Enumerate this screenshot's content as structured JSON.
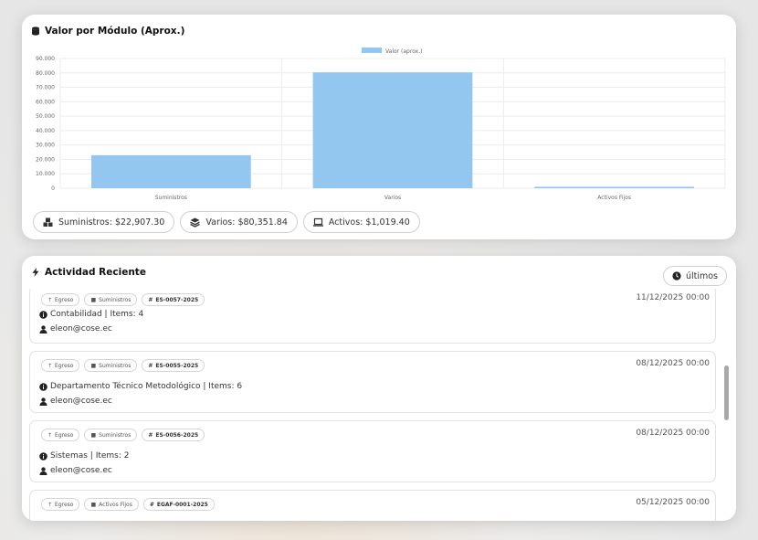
{
  "chart_card": {
    "title": "Valor por Módulo (Aprox.)",
    "icon": "database-icon",
    "pills": [
      {
        "label": "Suministros: $22,907.30",
        "icon": "boxes-icon"
      },
      {
        "label": "Varios: $80,351.84",
        "icon": "layers-icon"
      },
      {
        "label": "Activos: $1,019.40",
        "icon": "laptop-icon"
      }
    ]
  },
  "chart_data": {
    "type": "bar",
    "categories": [
      "Suministros",
      "Varios",
      "Activos Fijos"
    ],
    "series": [
      {
        "name": "Valor (aprox.)",
        "values": [
          22907.3,
          80351.84,
          1019.4
        ],
        "color": "#93c7ef"
      }
    ],
    "yticks": [
      "90.000",
      "80.000",
      "70.000",
      "60.000",
      "50.000",
      "40.000",
      "30.000",
      "20.000",
      "10.000",
      "0"
    ],
    "ylim": [
      0,
      90000
    ],
    "grid": true,
    "legend": "top-center"
  },
  "activity_card": {
    "title": "Actividad Reciente",
    "icon": "bolt-icon",
    "recent_button": {
      "label": "últimos",
      "icon": "clock-icon"
    },
    "entries": [
      {
        "tags": [
          "Egreso",
          "Suministros",
          "ES-0057-2025"
        ],
        "date": "11/12/2025 00:00",
        "detail": "Contabilidad | Items: 4",
        "user": "eleon@cose.ec"
      },
      {
        "tags": [
          "Egreso",
          "Suministros",
          "ES-0055-2025"
        ],
        "date": "08/12/2025 00:00",
        "detail": "Departamento Técnico Metodológico | Items: 6",
        "user": "eleon@cose.ec"
      },
      {
        "tags": [
          "Egreso",
          "Suministros",
          "ES-0056-2025"
        ],
        "date": "08/12/2025 00:00",
        "detail": "Sistemas | Items: 2",
        "user": "eleon@cose.ec"
      },
      {
        "tags": [
          "Egreso",
          "Activos Fijos",
          "EGAF-0001-2025"
        ],
        "date": "05/12/2025 00:00",
        "detail": "",
        "user": ""
      }
    ]
  }
}
